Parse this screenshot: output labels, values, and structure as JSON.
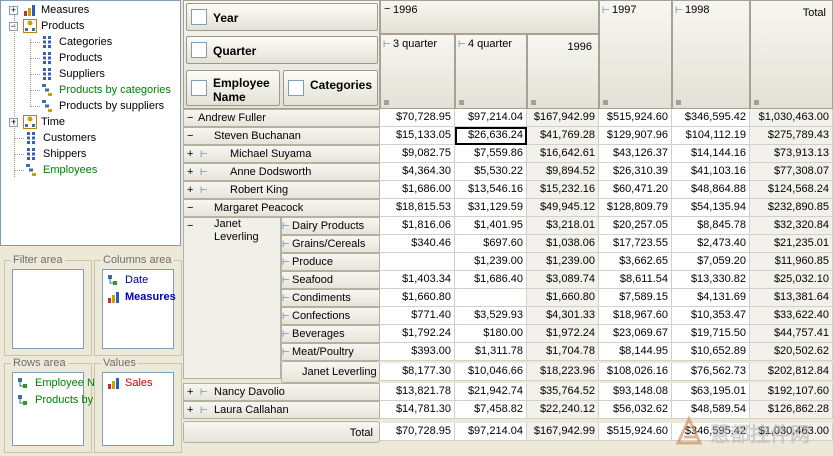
{
  "tree": {
    "items": [
      {
        "label": "Measures",
        "level": 0,
        "expand": "+",
        "icon": "bar-chart-icon"
      },
      {
        "label": "Products",
        "level": 0,
        "expand": "−",
        "icon": "hierarchy-icon"
      },
      {
        "label": "Categories",
        "level": 2,
        "icon": "level-icon"
      },
      {
        "label": "Products",
        "level": 2,
        "icon": "level-icon"
      },
      {
        "label": "Suppliers",
        "level": 2,
        "icon": "level-icon"
      },
      {
        "label": "Products by categories",
        "level": 2,
        "icon": "hierarchy-stair-icon",
        "green": true
      },
      {
        "label": "Products by suppliers",
        "level": 2,
        "icon": "hierarchy-stair-icon"
      },
      {
        "label": "Time",
        "level": 0,
        "expand": "+",
        "icon": "hierarchy-icon"
      },
      {
        "label": "Customers",
        "level": 1,
        "icon": "level-icon"
      },
      {
        "label": "Shippers",
        "level": 1,
        "icon": "level-icon"
      },
      {
        "label": "Employees",
        "level": 1,
        "icon": "hierarchy-stair-icon",
        "green": true
      }
    ]
  },
  "panels": {
    "filter": {
      "title": "Filter area",
      "items": []
    },
    "columns": {
      "title": "Columns area",
      "items": [
        {
          "label": "Date",
          "color": "#000080",
          "icon": "hierarchy-small-icon"
        },
        {
          "label": "Measures",
          "color": "#0000c0",
          "bold": true,
          "icon": "bar-chart-icon"
        }
      ]
    },
    "rows": {
      "title": "Rows area",
      "items": [
        {
          "label": "Employee N",
          "color": "#008000",
          "icon": "hierarchy-small-icon"
        },
        {
          "label": "Products by",
          "color": "#008000",
          "icon": "hierarchy-small-icon"
        }
      ]
    },
    "values": {
      "title": "Values",
      "items": [
        {
          "label": "Sales",
          "color": "#c00000",
          "icon": "bar-chart-icon"
        }
      ]
    }
  },
  "grid": {
    "field_buttons": {
      "year": "Year",
      "quarter": "Quarter",
      "employee_name": "Employee Name",
      "categories": "Categories"
    },
    "col_headers": {
      "year_1996": "1996",
      "year_1997": "1997",
      "year_1998": "1998",
      "total": "Total",
      "q3": "3 quarter",
      "q4": "4 quarter",
      "total_1996": "1996"
    },
    "rows": [
      {
        "label": "Andrew Fuller",
        "indent": 0,
        "exp": "−",
        "values": [
          "$70,728.95",
          "$97,214.04",
          "$167,942.99",
          "$515,924.60",
          "$346,595.42",
          "$1,030,463.00"
        ]
      },
      {
        "label": "Steven Buchanan",
        "indent": 1,
        "exp": "−",
        "values": [
          "$15,133.05",
          "$26,636.24",
          "$41,769.28",
          "$129,907.96",
          "$104,112.19",
          "$275,789.43"
        ]
      },
      {
        "label": "Michael Suyama",
        "indent": 2,
        "exp": "+",
        "values": [
          "$9,082.75",
          "$7,559.86",
          "$16,642.61",
          "$43,126.37",
          "$14,144.16",
          "$73,913.13"
        ]
      },
      {
        "label": "Anne Dodsworth",
        "indent": 2,
        "exp": "+",
        "values": [
          "$4,364.30",
          "$5,530.22",
          "$9,894.52",
          "$26,310.39",
          "$41,103.16",
          "$77,308.07"
        ]
      },
      {
        "label": "Robert King",
        "indent": 2,
        "exp": "+",
        "values": [
          "$1,686.00",
          "$13,546.16",
          "$15,232.16",
          "$60,471.20",
          "$48,864.88",
          "$124,568.24"
        ]
      },
      {
        "label": "Margaret Peacock",
        "indent": 1,
        "exp": "−",
        "values": [
          "$18,815.53",
          "$31,129.59",
          "$49,945.12",
          "$128,809.79",
          "$54,135.94",
          "$232,890.85"
        ]
      }
    ],
    "janet": {
      "label": "Janet Leverling",
      "exp": "−",
      "categories": [
        {
          "label": "Dairy Products",
          "values": [
            "$1,816.06",
            "$1,401.95",
            "$3,218.01",
            "$20,257.05",
            "$8,845.78",
            "$32,320.84"
          ]
        },
        {
          "label": "Grains/Cereals",
          "values": [
            "$340.46",
            "$697.60",
            "$1,038.06",
            "$17,723.55",
            "$2,473.40",
            "$21,235.01"
          ]
        },
        {
          "label": "Produce",
          "values": [
            "",
            "$1,239.00",
            "$1,239.00",
            "$3,662.65",
            "$7,059.20",
            "$11,960.85"
          ]
        },
        {
          "label": "Seafood",
          "values": [
            "$1,403.34",
            "$1,686.40",
            "$3,089.74",
            "$8,611.54",
            "$13,330.82",
            "$25,032.10"
          ]
        },
        {
          "label": "Condiments",
          "values": [
            "$1,660.80",
            "",
            "$1,660.80",
            "$7,589.15",
            "$4,131.69",
            "$13,381.64"
          ]
        },
        {
          "label": "Confections",
          "values": [
            "$771.40",
            "$3,529.93",
            "$4,301.33",
            "$18,967.60",
            "$10,353.47",
            "$33,622.40"
          ]
        },
        {
          "label": "Beverages",
          "values": [
            "$1,792.24",
            "$180.00",
            "$1,972.24",
            "$23,069.67",
            "$19,715.50",
            "$44,757.41"
          ]
        },
        {
          "label": "Meat/Poultry",
          "values": [
            "$393.00",
            "$1,311.78",
            "$1,704.78",
            "$8,144.95",
            "$10,652.89",
            "$20,502.62"
          ]
        }
      ],
      "total_label": "Janet Leverling",
      "total_values": [
        "$8,177.30",
        "$10,046.66",
        "$18,223.96",
        "$108,026.16",
        "$76,562.73",
        "$202,812.84"
      ]
    },
    "rows_after": [
      {
        "label": "Nancy Davolio",
        "exp": "+",
        "values": [
          "$13,821.78",
          "$21,942.74",
          "$35,764.52",
          "$93,148.08",
          "$63,195.01",
          "$192,107.60"
        ]
      },
      {
        "label": "Laura Callahan",
        "exp": "+",
        "values": [
          "$14,781.30",
          "$7,458.82",
          "$22,240.12",
          "$56,032.62",
          "$48,589.54",
          "$126,862.28"
        ]
      }
    ],
    "grand_total": {
      "label": "Total",
      "values": [
        "$70,728.95",
        "$97,214.04",
        "$167,942.99",
        "$515,924.60",
        "$346,595.42",
        "$1,030,463.00"
      ]
    }
  },
  "watermark": {
    "text": "慧都控件网"
  },
  "colors": {
    "accent": "#3a6ea5",
    "green": "#008000",
    "tree_border": "#7f9db9"
  }
}
